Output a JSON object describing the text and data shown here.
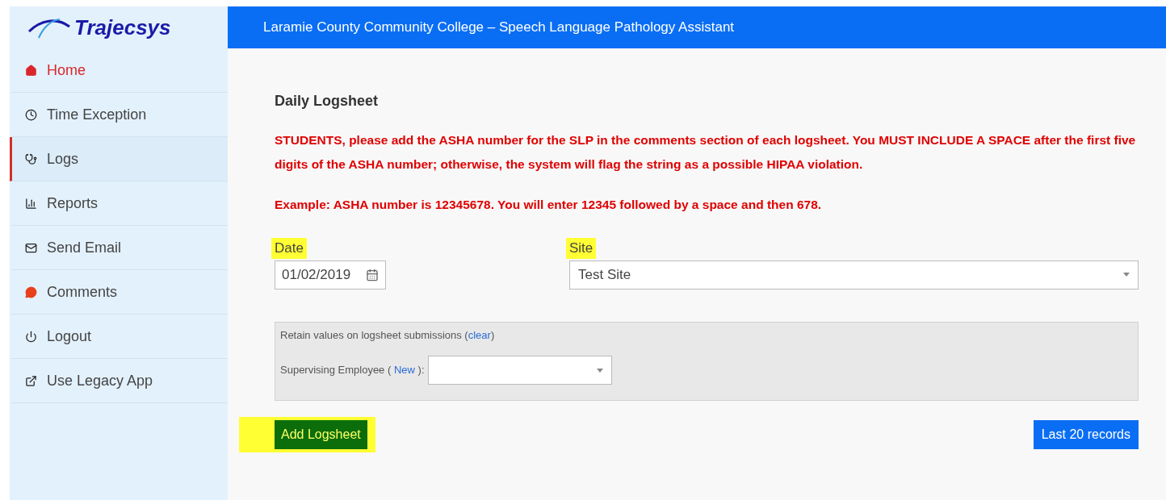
{
  "brand": {
    "name": "Trajecsys"
  },
  "header": {
    "title": "Laramie County Community College – Speech Language Pathology Assistant"
  },
  "sidebar": {
    "items": [
      {
        "kind": "home",
        "label": "Home",
        "accent": true,
        "selected": false
      },
      {
        "kind": "clock",
        "label": "Time Exception",
        "accent": false,
        "selected": false
      },
      {
        "kind": "stethoscope",
        "label": "Logs",
        "accent": false,
        "selected": true
      },
      {
        "kind": "chart",
        "label": "Reports",
        "accent": false,
        "selected": false
      },
      {
        "kind": "mail",
        "label": "Send Email",
        "accent": false,
        "selected": false
      },
      {
        "kind": "comment",
        "label": "Comments",
        "accent": false,
        "selected": false
      },
      {
        "kind": "power",
        "label": "Logout",
        "accent": false,
        "selected": false
      },
      {
        "kind": "external",
        "label": "Use Legacy App",
        "accent": false,
        "selected": false
      }
    ]
  },
  "page": {
    "title": "Daily Logsheet",
    "notices": [
      "STUDENTS, please add the ASHA number for the SLP in the comments section of each logsheet. You MUST INCLUDE A SPACE after the first five digits of the ASHA number; otherwise, the system will flag the string as a possible HIPAA violation.",
      "Example: ASHA number is 12345678. You will enter 12345 followed by a space and then 678."
    ],
    "date": {
      "label": "Date",
      "value": "01/02/2019",
      "highlighted": true
    },
    "site": {
      "label": "Site",
      "value": "Test Site",
      "highlighted": true
    },
    "retain": {
      "text": "Retain values on logsheet submissions (",
      "link": "clear",
      "after": ")"
    },
    "supervisor": {
      "label": "Supervising Employee (",
      "link": "New",
      "after": "):"
    },
    "add_button": {
      "label": "Add Logsheet",
      "highlighted": true
    },
    "records_button": {
      "label": "Last 20 records"
    }
  }
}
